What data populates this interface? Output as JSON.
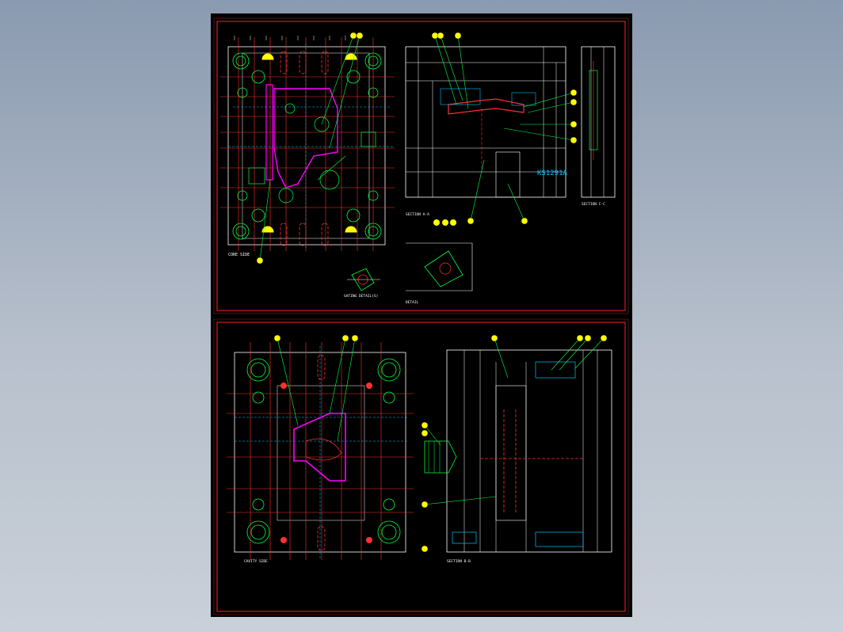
{
  "drawing": {
    "title": "KS1291A",
    "views": {
      "core_side": "CORE SIDE",
      "cavity_side": "CAVITY SIDE",
      "section_aa": "SECTION A-A",
      "section_bb": "SECTION B-B",
      "section_cc": "SECTION C-C",
      "section_bb_lower": "SECTION B-B",
      "gating_detail": "GATING DETAIL(S)",
      "detail": "DETAIL"
    }
  },
  "colors": {
    "background": "#000000",
    "frame": "#ff2020",
    "outline": "#ffffff",
    "center_line": "#ff3030",
    "dimension": "#00c0ff",
    "balloon": "#ffff00",
    "leader": "#00ff40",
    "part_outline": "#ff00ff",
    "hidden": "#2060ff"
  }
}
